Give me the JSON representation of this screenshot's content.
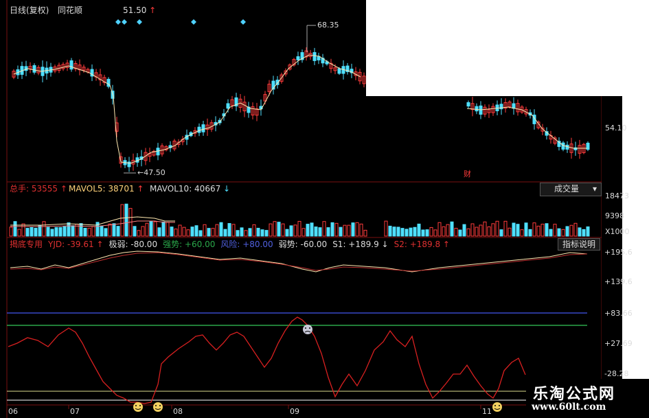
{
  "window": {
    "title": "日线(复权)",
    "app": "同花顺",
    "top_price_marker": "51.50"
  },
  "price_panel": {
    "high_label": "68.35",
    "low_label": "47.50",
    "right_tick": "54.10",
    "cai_badge": "财"
  },
  "volume_panel": {
    "total_label": "总手: 53555",
    "mavol5_label": "MAVOL5: 38701",
    "mavol10_label": "MAVOL10: 40667",
    "dropdown_label": "成交量",
    "ticks": [
      "18473",
      "9398",
      "X1000"
    ]
  },
  "indicator_panel": {
    "name": "揭底专用",
    "values": [
      {
        "text": "YJD: -39.61",
        "color": "#e03030"
      },
      {
        "text": "极弱: -80.00",
        "color": "#dddddd"
      },
      {
        "text": "强势: +60.00",
        "color": "#2aa84a"
      },
      {
        "text": "风险: +80.00",
        "color": "#5060e0"
      },
      {
        "text": "弱势: -60.00",
        "color": "#dddddd"
      },
      {
        "text": "S1: +189.9",
        "color": "#dddddd"
      },
      {
        "text": "S2: +189.8",
        "color": "#e03030"
      }
    ],
    "help_button": "指标说明",
    "ticks": [
      "+195.6",
      "+139.6",
      "+83.66",
      "+27.69",
      "-28.28"
    ]
  },
  "x_axis": {
    "labels": [
      "06",
      "07",
      "08",
      "09",
      "11"
    ]
  },
  "watermark": {
    "line1": "乐淘公式网",
    "line2": "www.60lt.com"
  },
  "colors": {
    "up": "#ff3b3b",
    "down": "#4fe0ff",
    "grid_red": "#7a1010",
    "ma_line": "#ffe8b0"
  }
}
